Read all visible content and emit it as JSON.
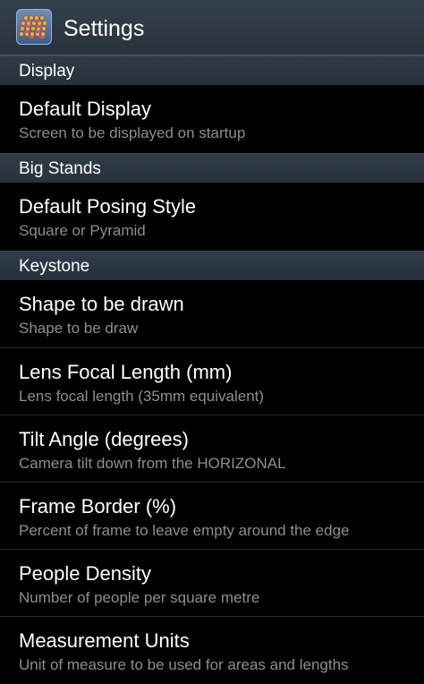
{
  "header": {
    "title": "Settings",
    "icon": "app-icon-crowd"
  },
  "categories": [
    {
      "label": "Display",
      "items": [
        {
          "title": "Default Display",
          "summary": "Screen to be displayed on startup"
        }
      ]
    },
    {
      "label": "Big Stands",
      "items": [
        {
          "title": "Default Posing Style",
          "summary": "Square or Pyramid"
        }
      ]
    },
    {
      "label": "Keystone",
      "items": [
        {
          "title": "Shape to be drawn",
          "summary": "Shape to be draw"
        },
        {
          "title": "Lens Focal Length (mm)",
          "summary": "Lens focal length (35mm equivalent)"
        },
        {
          "title": "Tilt Angle (degrees)",
          "summary": "Camera tilt down from the HORIZONAL"
        },
        {
          "title": "Frame Border (%)",
          "summary": "Percent of frame to leave empty around the edge"
        },
        {
          "title": "People Density",
          "summary": "Number of people per square metre"
        },
        {
          "title": "Measurement Units",
          "summary": "Unit of measure to be used for areas and lengths"
        }
      ]
    }
  ],
  "colors": {
    "background": "#000000",
    "header": "#2c3742",
    "category": "#2a3540",
    "title_text": "#ffffff",
    "summary_text": "#8e8e8e"
  }
}
